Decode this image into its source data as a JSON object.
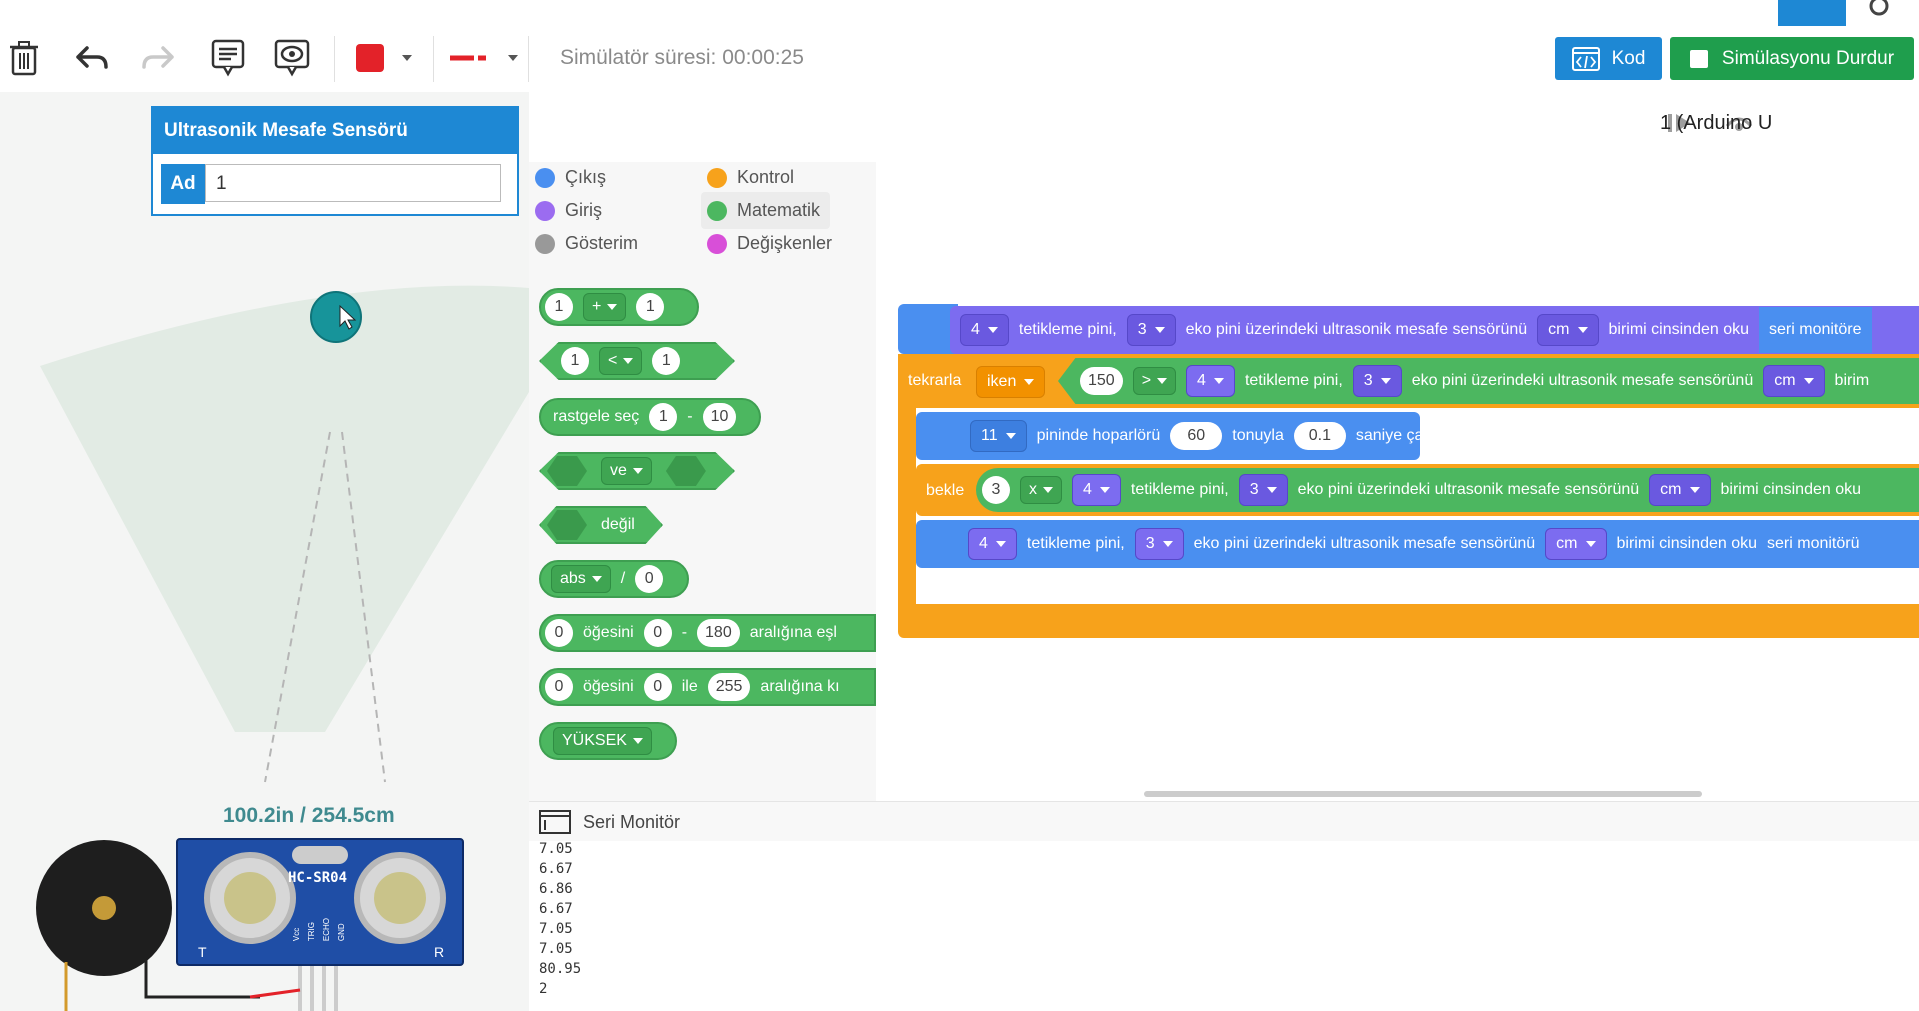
{
  "toolbar": {
    "sim_time": "Simülatör süresi: 00:00:25",
    "kod_label": "Kod",
    "stop_label": "Simülasyonu Durdur",
    "color": "#e32229"
  },
  "properties": {
    "title": "Ultrasonik Mesafe Sensörü",
    "name_label": "Ad",
    "name_value": "1"
  },
  "sensor": {
    "reading": "100.2in / 254.5cm",
    "chip": "HC-SR04",
    "pins": [
      "Vcc",
      "TRIG",
      "ECHO",
      "GND"
    ],
    "t": "T",
    "r": "R"
  },
  "device_select": "1 (Arduino U",
  "categories": [
    {
      "label": "Çıkış",
      "color": "#4a8ff0"
    },
    {
      "label": "Kontrol",
      "color": "#f7a21b"
    },
    {
      "label": "Giriş",
      "color": "#9b6cf0"
    },
    {
      "label": "Matematik",
      "color": "#4cb760"
    },
    {
      "label": "Gösterim",
      "color": "#999999"
    },
    {
      "label": "Değişkenler",
      "color": "#d84fd8"
    }
  ],
  "palette_blocks": {
    "add": {
      "a": "1",
      "op": "+",
      "b": "1"
    },
    "compare": {
      "a": "1",
      "op": "<",
      "b": "1"
    },
    "random": {
      "label": "rastgele seç",
      "a": "1",
      "dash": "-",
      "b": "10"
    },
    "and": {
      "op": "ve"
    },
    "not": {
      "label": "değil"
    },
    "abs": {
      "op": "abs",
      "slash": "/",
      "v": "0"
    },
    "map": {
      "a": "0",
      "l1": "öğesini",
      "b": "0",
      "dash": "-",
      "c": "180",
      "l2": "aralığına eşl"
    },
    "constrain": {
      "a": "0",
      "l1": "öğesini",
      "b": "0",
      "l2": "ile",
      "c": "255",
      "l3": "aralığına kı"
    },
    "high": {
      "label": "YÜKSEK"
    }
  },
  "code": {
    "line1": {
      "trig": "4",
      "t1": "tetikleme pini,",
      "echo": "3",
      "t2": "eko pini üzerindeki ultrasonik mesafe sensörünü",
      "unit": "cm",
      "t3": "birimi cinsinden oku",
      "t4": "seri monitöre"
    },
    "loop": {
      "label": "tekrarla",
      "mode": "iken",
      "num": "150",
      "op": ">",
      "trig": "4",
      "t1": "tetikleme pini,",
      "echo": "3",
      "t2": "eko pini üzerindeki ultrasonik mesafe sensörünü",
      "unit": "cm",
      "t3": "birim"
    },
    "tone": {
      "pin": "11",
      "t1": "pininde hoparlörü",
      "freq": "60",
      "t2": "tonuyla",
      "dur": "0.1",
      "t3": "saniye çal"
    },
    "wait": {
      "label": "bekle",
      "n": "3",
      "op": "x",
      "trig": "4",
      "t1": "tetikleme pini,",
      "echo": "3",
      "t2": "eko pini üzerindeki ultrasonik mesafe sensörünü",
      "unit": "cm",
      "t3": "birimi cinsinden oku"
    },
    "line4": {
      "trig": "4",
      "t1": "tetikleme pini,",
      "echo": "3",
      "t2": "eko pini üzerindeki ultrasonik mesafe sensörünü",
      "unit": "cm",
      "t3": "birimi cinsinden oku",
      "t4": "seri monitörü"
    }
  },
  "monitor": {
    "title": "Seri Monitör",
    "lines": [
      "7.05",
      "6.67",
      "6.86",
      "6.67",
      "7.05",
      "7.05",
      "80.95",
      "2"
    ]
  }
}
